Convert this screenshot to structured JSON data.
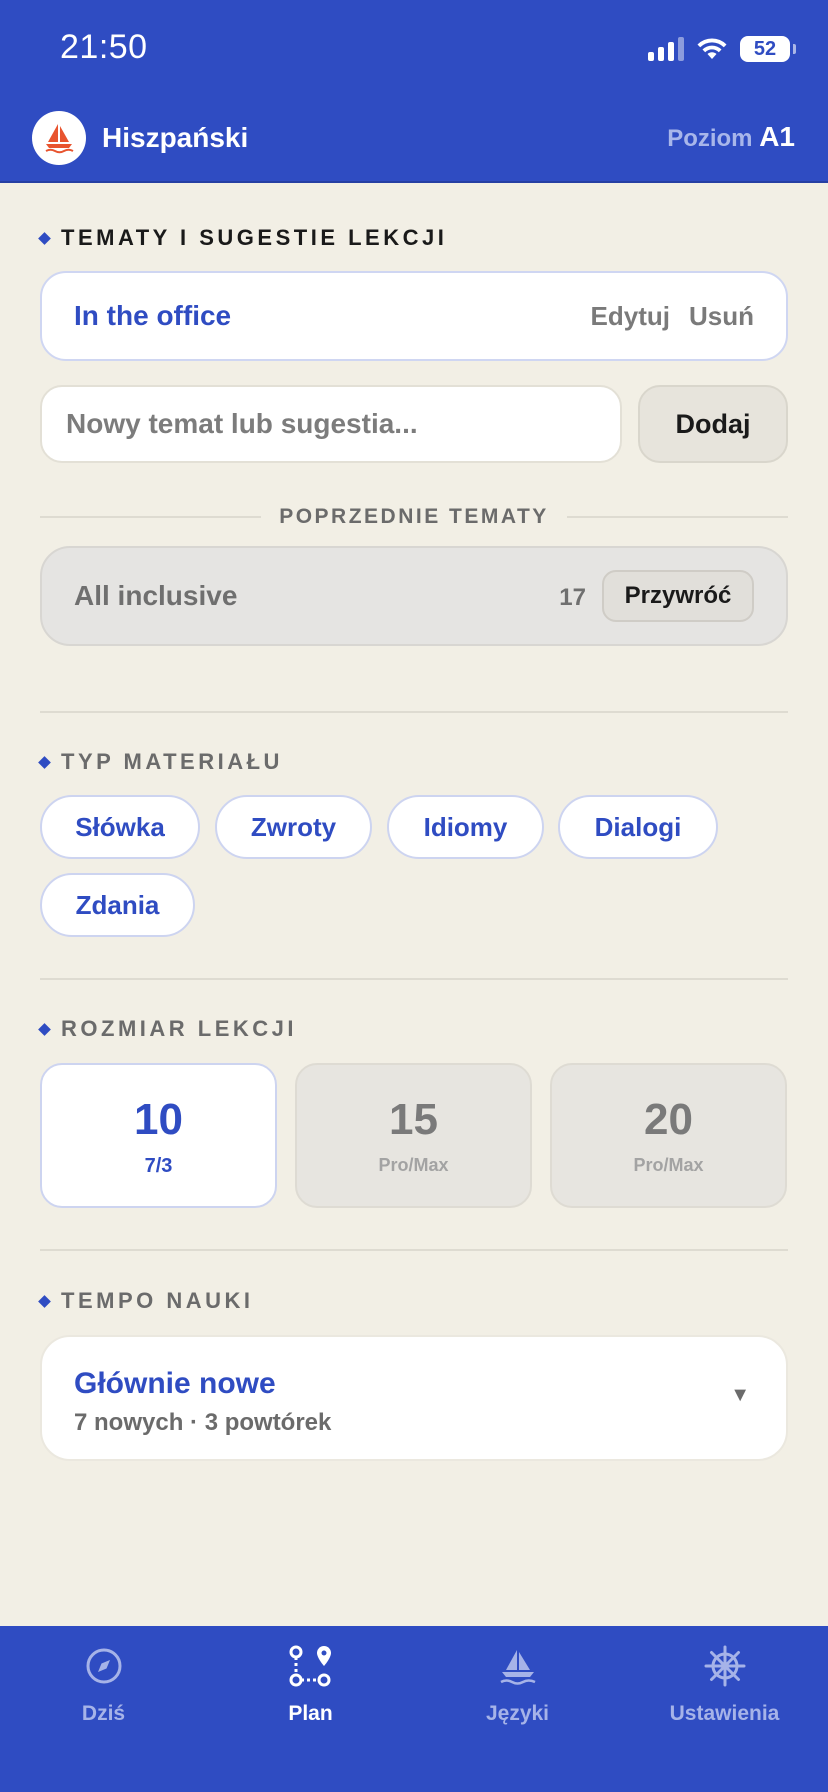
{
  "status_bar": {
    "time": "21:50",
    "battery": "52"
  },
  "header": {
    "title": "Hiszpański",
    "level_label": "Poziom",
    "level_value": "A1"
  },
  "topics": {
    "heading": "TEMATY I SUGESTIE LEKCJI",
    "current": {
      "name": "In the office",
      "edit_label": "Edytuj",
      "delete_label": "Usuń"
    },
    "new_input": {
      "value": "",
      "placeholder": "Nowy temat lub sugestia..."
    },
    "add_label": "Dodaj",
    "previous_heading": "POPRZEDNIE TEMATY",
    "previous": [
      {
        "name": "All inclusive",
        "count": "17",
        "restore_label": "Przywróć"
      }
    ]
  },
  "material": {
    "heading": "TYP MATERIAŁU",
    "chips": [
      {
        "label": "Słówka"
      },
      {
        "label": "Zwroty"
      },
      {
        "label": "Idiomy"
      },
      {
        "label": "Dialogi"
      },
      {
        "label": "Zdania"
      }
    ]
  },
  "lesson_size": {
    "heading": "ROZMIAR LEKCJI",
    "options": [
      {
        "value": "10",
        "sub": "7/3",
        "selected": true
      },
      {
        "value": "15",
        "sub": "Pro/Max",
        "selected": false
      },
      {
        "value": "20",
        "sub": "Pro/Max",
        "selected": false
      }
    ]
  },
  "pace": {
    "heading": "TEMPO NAUKI",
    "selected_title": "Głównie nowe",
    "selected_sub": "7 nowych · 3 powtórek",
    "caret": "▼"
  },
  "tabs": [
    {
      "label": "Dziś",
      "icon": "compass-icon",
      "active": false
    },
    {
      "label": "Plan",
      "icon": "route-icon",
      "active": true
    },
    {
      "label": "Języki",
      "icon": "sailboat-icon",
      "active": false
    },
    {
      "label": "Ustawienia",
      "icon": "ship-wheel-icon",
      "active": false
    }
  ],
  "colors": {
    "accent": "#2f4cc2",
    "background": "#f2efe5",
    "logo": "#e8542f"
  }
}
